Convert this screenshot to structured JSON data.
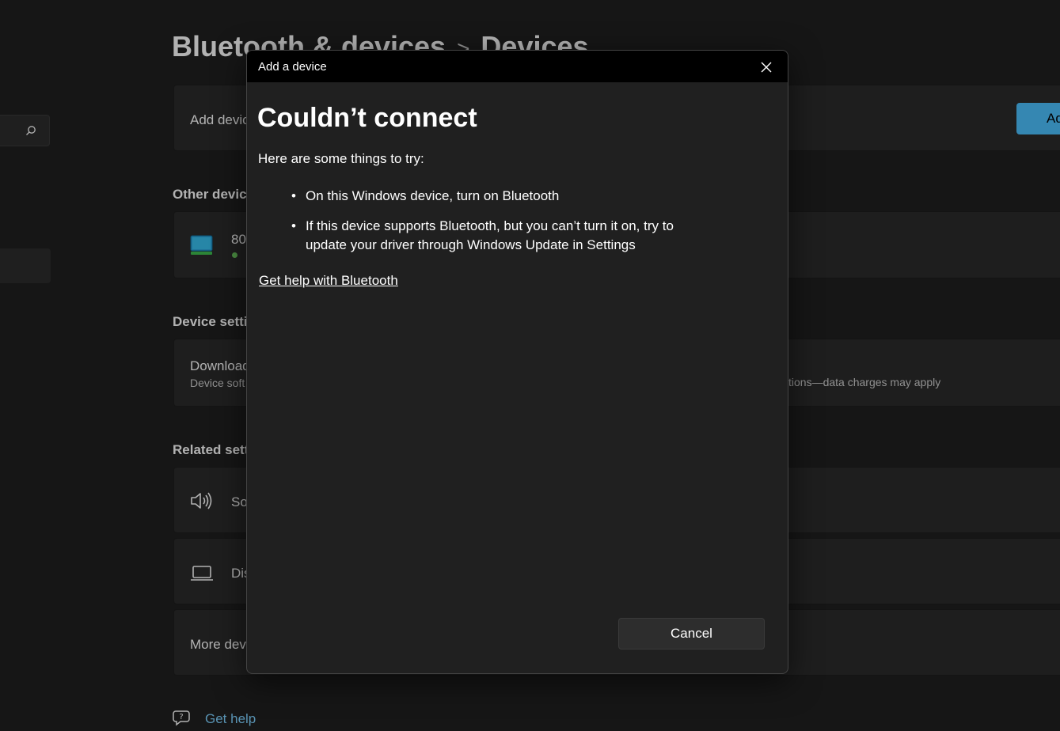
{
  "page": {
    "breadcrumb_parent": "Bluetooth & devices",
    "breadcrumb_separator": ">",
    "breadcrumb_current": "Devices"
  },
  "background": {
    "add_device_label": "Add device",
    "add_button_label": "Ad",
    "other_devices_heading": "Other devices",
    "device_name": "80",
    "device_settings_heading": "Device settings",
    "download_label": "Download",
    "download_sub": "Device soft",
    "download_note": "tions—data charges may apply",
    "related_settings_heading": "Related settings",
    "sound_label": "So",
    "display_label": "Dis",
    "more_devices_label": "More dev",
    "get_help_label": "Get help"
  },
  "dialog": {
    "title": "Add a device",
    "heading": "Couldn’t connect",
    "intro": "Here are some things to try:",
    "tips": [
      "On this Windows device, turn on Bluetooth",
      "If this device supports Bluetooth, but you can’t turn it on, try to update your driver through Windows Update in Settings"
    ],
    "help_link": "Get help with Bluetooth",
    "cancel_label": "Cancel"
  },
  "colors": {
    "accent": "#4cc2ff",
    "status_green": "#6ccb5f",
    "dialog_titlebar": "#000000",
    "background": "#202020"
  }
}
